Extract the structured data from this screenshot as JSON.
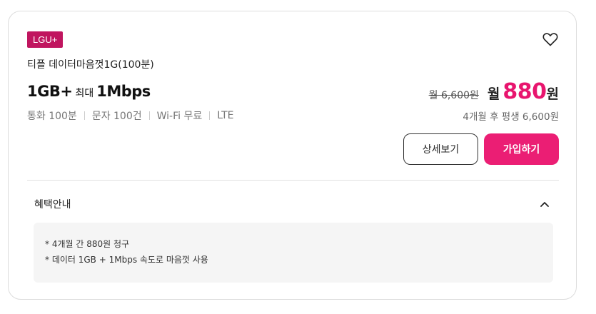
{
  "carrier": {
    "badge": "LGU+"
  },
  "plan": {
    "name": "티플 데이터마음껏1G(100분)",
    "data_amount": "1GB+",
    "max_label": "최대",
    "speed": "1Mbps",
    "specs": [
      "통화 100분",
      "문자 100건",
      "Wi-Fi 무료",
      "LTE"
    ]
  },
  "price": {
    "original": "월 6,600원",
    "month_label": "월",
    "discounted": "880",
    "unit": "원",
    "after_note": "4개월 후 평생 6,600원"
  },
  "buttons": {
    "detail": "상세보기",
    "join": "가입하기"
  },
  "benefits": {
    "title": "혜택안내",
    "items": [
      "* 4개월 간 880원 청구",
      "* 데이터 1GB + 1Mbps 속도로 마음껏 사용"
    ]
  },
  "icons": {
    "favorite": "heart-icon",
    "collapse": "chevron-up-icon"
  },
  "colors": {
    "brand": "#c0155f",
    "accent": "#eb1e74",
    "price": "#e8156e"
  }
}
